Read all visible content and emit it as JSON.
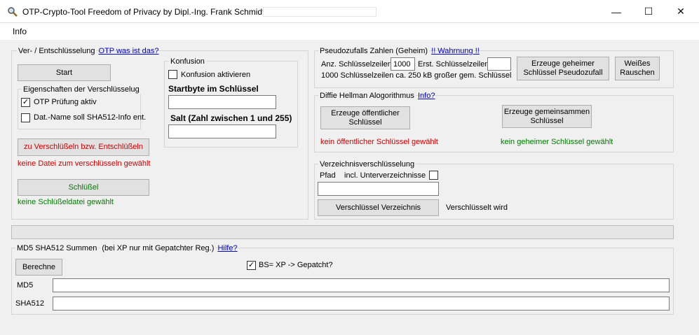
{
  "window": {
    "title": "OTP-Crypto-Tool Freedom of Privacy by Dipl.-Ing. Frank Schmidt",
    "minimize": "—",
    "maximize": "☐",
    "close": "✕"
  },
  "menu": {
    "info": "Info"
  },
  "encrypt": {
    "group_label": "Ver- / Entschlüsselung",
    "otp_link": "OTP was ist das?",
    "start_button": "Start",
    "props_label": "Eigenschaften der Verschlüsselug",
    "otp_check_label": "OTP Prüfung aktiv",
    "otp_checked": true,
    "sha_check_label": "Dat.-Name soll SHA512-Info ent.",
    "sha_checked": false,
    "file_button": "zu Verschlüßeln bzw. Entschlüßeln",
    "file_status": "keine Datei zum verschlüsseln gewählt",
    "key_button": "Schlüßel",
    "key_status": "keine Schlüßeldatei gewählt"
  },
  "confusion": {
    "group_label": "Konfusion",
    "activate_label": "Konfusion aktivieren",
    "activate_checked": false,
    "startbyte_label": "Startbyte im Schlüssel",
    "startbyte_value": "",
    "salt_label": "Salt (Zahl zwischen 1 und 255)",
    "salt_value": ""
  },
  "pseudo": {
    "group_label": "Pseudozufalls Zahlen (Geheim)",
    "warning_link": "!! Wahrnung !!",
    "count_label": "Anz. Schlüsselzeilen",
    "count_value": "1000",
    "first_label": "Erst. Schlüsselzeilen",
    "first_value": "",
    "info_text": "1000 Schlüsselzeilen ca.  250 kB großer gem.  Schlüssel",
    "generate_button": "Erzeuge geheimer Schlüssel Pseudozufall",
    "noise_button": "Weißes Rauschen"
  },
  "dh": {
    "group_label": "Diffie Hellman Alogorithmus",
    "info_link": "Info?",
    "public_button": "Erzeuge öffentlicher Schlüssel",
    "shared_button": "Erzeuge gemeinsammen Schlüssel",
    "public_status": "kein öffentlicher Schlüssel  gewählt",
    "secret_status": "kein geheimer Schlüssel gewählt"
  },
  "dir": {
    "group_label": "Verzeichnisverschlüsselung",
    "path_label": "Pfad",
    "subdirs_label": "incl. Unterverzeichnisse",
    "subdirs_checked": false,
    "path_value": "",
    "encrypt_button": "Verschlüssel Verzeichnis",
    "status": "Verschlüsselt wird"
  },
  "progress": {
    "value": 0
  },
  "hash": {
    "group_label": "MD5  SHA512 Summen",
    "note": "(bei XP nur mit Gepatchter Reg.)",
    "help_link": "Hilfe?",
    "calc_button": "Berechne",
    "bs_label": "BS= XP -> Gepatcht?",
    "bs_checked": true,
    "md5_label": "MD5",
    "md5_value": "",
    "sha_label": "SHA512",
    "sha_value": ""
  }
}
